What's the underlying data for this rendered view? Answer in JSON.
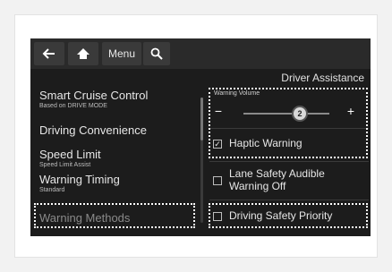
{
  "topbar": {
    "back_icon": "arrow-left-icon",
    "home_icon": "home-icon",
    "menu_label": "Menu",
    "search_icon": "search-icon"
  },
  "left_menu": {
    "items": [
      {
        "label": "Smart Cruise Control",
        "sub": "Based on DRIVE MODE"
      },
      {
        "label": "Driving Convenience",
        "sub": ""
      },
      {
        "label": "Speed Limit",
        "sub": "Speed Limit Assist"
      },
      {
        "label": "Warning Timing",
        "sub": "Standard"
      },
      {
        "label": "Warning Methods",
        "sub": ""
      }
    ]
  },
  "right_panel": {
    "title": "Driver Assistance",
    "warning_volume": {
      "label": "Warning Volume",
      "value": "2",
      "minus": "−",
      "plus": "+"
    },
    "options": [
      {
        "label": "Haptic Warning",
        "checked": true
      },
      {
        "label": "Lane Safety Audible Warning Off",
        "checked": false
      },
      {
        "label": "Driving Safety Priority",
        "checked": false
      }
    ]
  },
  "colors": {
    "screen_bg": "#1c1c1c",
    "topbar_bg": "#2a2a2a",
    "highlight_border": "#ffffff",
    "text": "#e6e6e6"
  }
}
